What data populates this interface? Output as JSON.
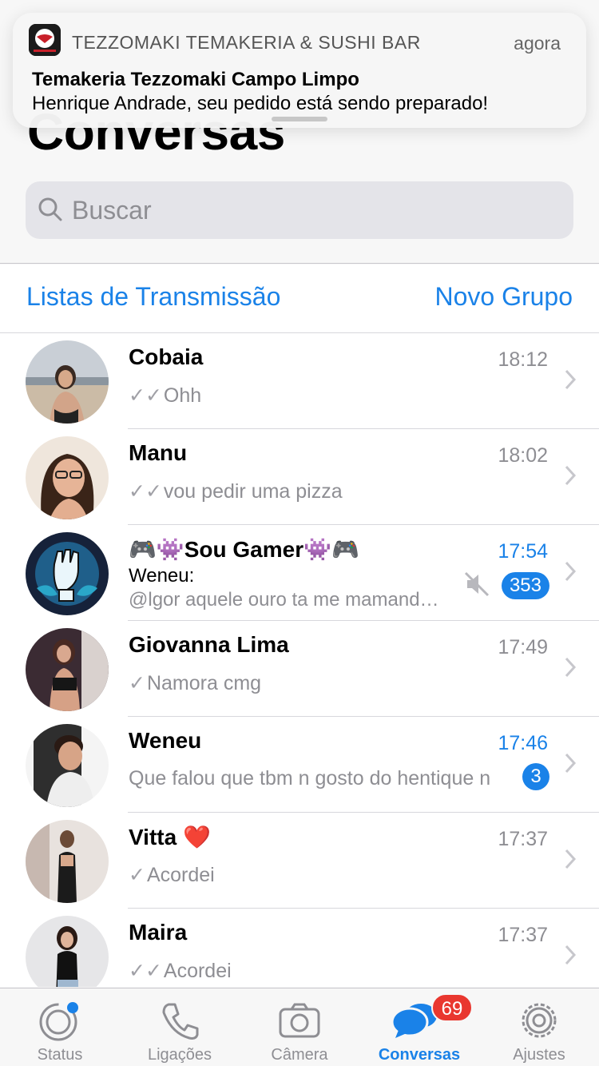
{
  "header": {
    "title": "Conversas",
    "search_placeholder": "Buscar"
  },
  "links": {
    "broadcast": "Listas de Transmissão",
    "new_group": "Novo Grupo"
  },
  "chats": [
    {
      "name": "Cobaia",
      "time": "18:12",
      "ticks": "✓✓",
      "preview": "Ohh"
    },
    {
      "name": "Manu",
      "time": "18:02",
      "ticks": "✓✓",
      "preview": "vou pedir uma pizza"
    },
    {
      "name": "🎮👾Sou Gamer👾🎮",
      "time": "17:54",
      "sender": "Weneu:",
      "preview": "@lgor  aquele ouro ta me mamand…",
      "badge": "353",
      "muted": true
    },
    {
      "name": "Giovanna Lima",
      "time": "17:49",
      "ticks": "✓",
      "preview": "Namora cmg"
    },
    {
      "name": "Weneu",
      "time": "17:46",
      "preview": "Que falou que tbm n gosto do hentique n",
      "badge": "3"
    },
    {
      "name": "Vitta",
      "name_emoji": "❤️",
      "time": "17:37",
      "ticks": "✓",
      "preview": "Acordei"
    },
    {
      "name": "Maira",
      "time": "17:37",
      "ticks": "✓✓",
      "preview": "Acordei"
    }
  ],
  "tabs": {
    "status": "Status",
    "calls": "Ligações",
    "camera": "Câmera",
    "chats": "Conversas",
    "chats_badge": "69",
    "settings": "Ajustes"
  },
  "notification": {
    "app": "TEZZOMAKI TEMAKERIA & SUSHI BAR",
    "time": "agora",
    "title": "Temakeria Tezzomaki Campo Limpo",
    "body": "Henrique Andrade, seu pedido está sendo preparado!"
  },
  "colors": {
    "accent": "#1a82e8",
    "badge_red": "#e9372f",
    "muted_gray": "#8e8e93"
  },
  "icons": {
    "search": "search-icon",
    "chevron": "chevron-right-icon",
    "mute": "mute-icon",
    "status": "status-icon",
    "calls": "phone-icon",
    "camera": "camera-icon",
    "chats": "chat-bubbles-icon",
    "settings": "gear-icon"
  }
}
